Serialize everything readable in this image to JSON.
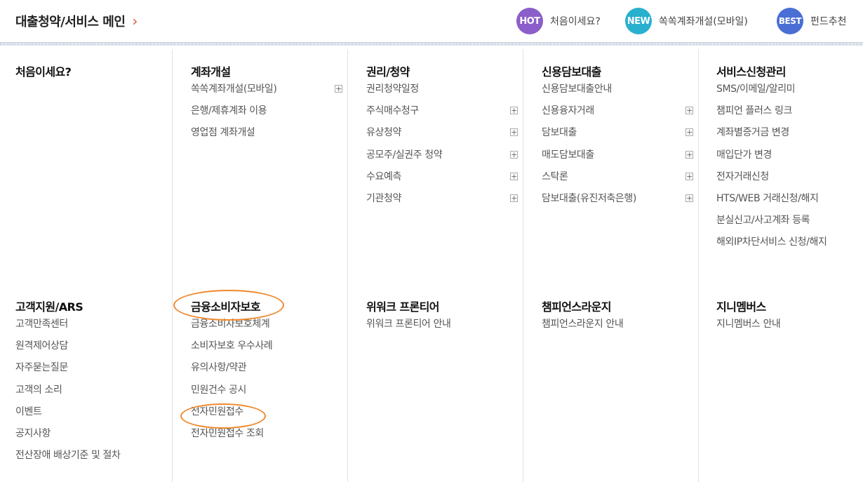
{
  "header": {
    "title": "대출청약/서비스 메인",
    "chevron": "›",
    "quick_links": [
      {
        "badge": "HOT",
        "label": "처음이세요?",
        "color": "#8b5ec9"
      },
      {
        "badge": "NEW",
        "label": "쏙쏙계좌개설(모바일)",
        "color": "#29b0cf"
      },
      {
        "badge": "BEST",
        "label": "펀드추천",
        "color": "#4a6fd4"
      }
    ]
  },
  "menu": {
    "row1": [
      {
        "title": "처음이세요?",
        "items": []
      },
      {
        "title": "계좌개설",
        "items": [
          {
            "label": "쏙쏙계좌개설(모바일)",
            "expand": true
          },
          {
            "label": "은행/제휴계좌 이용",
            "expand": false
          },
          {
            "label": "영업점 계좌개설",
            "expand": false
          }
        ]
      },
      {
        "title": "권리/청약",
        "items": [
          {
            "label": "권리청약일정",
            "expand": false
          },
          {
            "label": "주식매수청구",
            "expand": true
          },
          {
            "label": "유상청약",
            "expand": true
          },
          {
            "label": "공모주/실권주 청약",
            "expand": true
          },
          {
            "label": "수요예측",
            "expand": true
          },
          {
            "label": "기관청약",
            "expand": true
          }
        ]
      },
      {
        "title": "신용담보대출",
        "items": [
          {
            "label": "신용담보대출안내",
            "expand": false
          },
          {
            "label": "신용융자거래",
            "expand": true
          },
          {
            "label": "담보대출",
            "expand": true
          },
          {
            "label": "매도담보대출",
            "expand": true
          },
          {
            "label": "스탁론",
            "expand": true
          },
          {
            "label": "담보대출(유진저축은행)",
            "expand": true
          }
        ]
      },
      {
        "title": "서비스신청관리",
        "items": [
          {
            "label": "SMS/이메일/알리미",
            "expand": false
          },
          {
            "label": "챔피언 플러스 링크",
            "expand": false
          },
          {
            "label": "계좌별증거금 변경",
            "expand": false
          },
          {
            "label": "매입단가 변경",
            "expand": false
          },
          {
            "label": "전자거래신청",
            "expand": false
          },
          {
            "label": "HTS/WEB 거래신청/해지",
            "expand": false
          },
          {
            "label": "분실신고/사고계좌 등록",
            "expand": false
          },
          {
            "label": "해외IP차단서비스 신청/해지",
            "expand": false
          }
        ]
      }
    ],
    "row2": [
      {
        "title": "고객지원/ARS",
        "items": [
          {
            "label": "고객만족센터",
            "expand": false
          },
          {
            "label": "원격제어상담",
            "expand": false
          },
          {
            "label": "자주묻는질문",
            "expand": false
          },
          {
            "label": "고객의 소리",
            "expand": false
          },
          {
            "label": "이벤트",
            "expand": false
          },
          {
            "label": "공지사항",
            "expand": false
          },
          {
            "label": "전산장애 배상기준 및 절차",
            "expand": false
          }
        ]
      },
      {
        "title": "금융소비자보호",
        "items": [
          {
            "label": "금융소비자보호체계",
            "expand": false
          },
          {
            "label": "소비자보호 우수사례",
            "expand": false
          },
          {
            "label": "유의사항/약관",
            "expand": false
          },
          {
            "label": "민원건수 공시",
            "expand": false
          },
          {
            "label": "전자민원접수",
            "expand": false
          },
          {
            "label": "전자민원접수 조회",
            "expand": false
          }
        ]
      },
      {
        "title": "위워크 프론티어",
        "items": [
          {
            "label": "위워크 프론티어 안내",
            "expand": false
          }
        ]
      },
      {
        "title": "챔피언스라운지",
        "items": [
          {
            "label": "챔피언스라운지 안내",
            "expand": false
          }
        ]
      },
      {
        "title": "지니멤버스",
        "items": [
          {
            "label": "지니멤버스 안내",
            "expand": false
          }
        ]
      }
    ]
  },
  "expand_symbol": "+",
  "highlight_color": "#f0882c"
}
